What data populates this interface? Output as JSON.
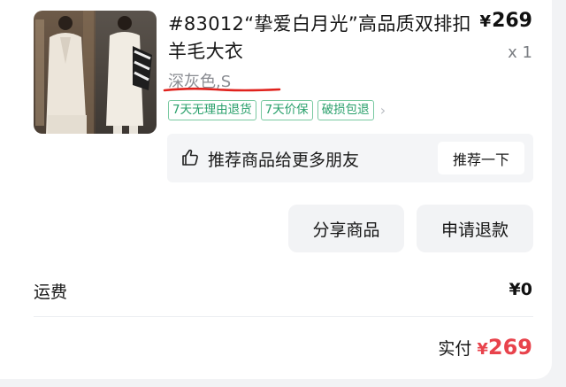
{
  "product": {
    "title": "#83012“挚爱白月光”高品质双排扣羊毛大衣",
    "price_symbol": "¥",
    "price": "269",
    "quantity": "x 1",
    "variant": "深灰色,S",
    "tags": [
      "7天无理由退货",
      "7天价保",
      "破损包退"
    ]
  },
  "recommend": {
    "text": "推荐商品给更多朋友",
    "button": "推荐一下"
  },
  "actions": {
    "share": "分享商品",
    "refund": "申请退款"
  },
  "shipping": {
    "label": "运费",
    "value": "¥0"
  },
  "total": {
    "label": "实付",
    "symbol": "¥",
    "value": "269"
  },
  "colors": {
    "tag_green": "#29a06b",
    "price_red": "#e8434c",
    "underline_red": "#e0221d"
  }
}
